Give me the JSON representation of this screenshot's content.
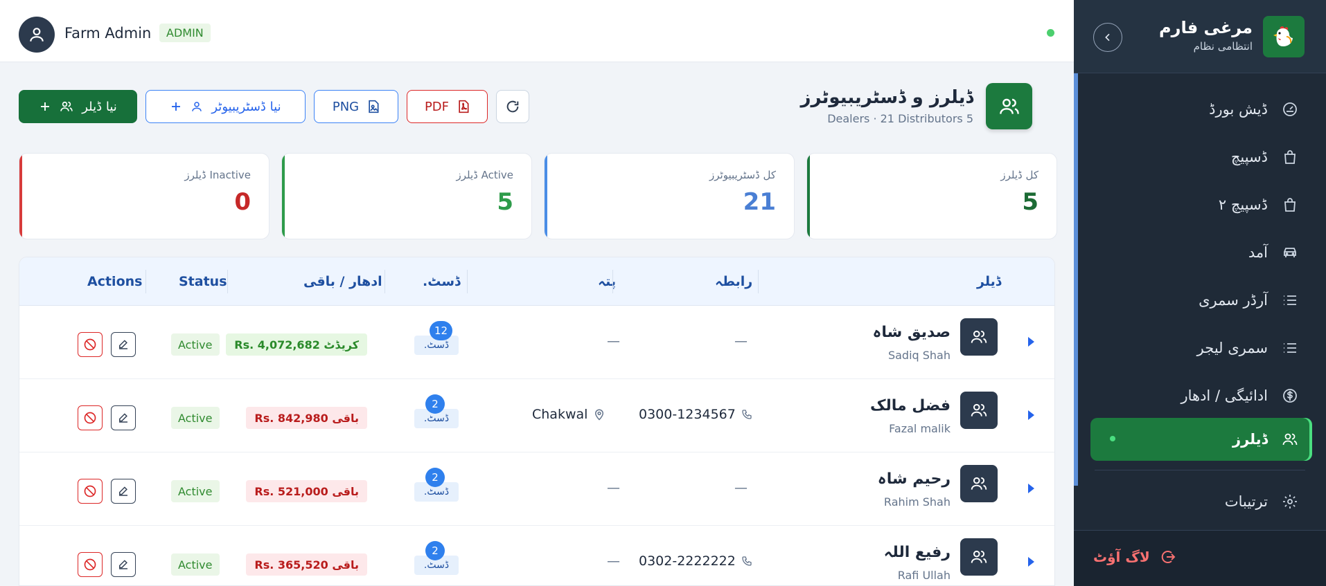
{
  "topbar": {
    "user_name": "Farm Admin",
    "role": "ADMIN"
  },
  "toolbar": {
    "new_dealer": "نیا ڈیلر",
    "new_distributor": "نیا ڈسٹریبیوٹر",
    "png": "PNG",
    "pdf": "PDF"
  },
  "page": {
    "title": "ڈیلرز و ڈسٹریبیوٹرز",
    "subtitle": "Dealers · 21 Distributors 5"
  },
  "stats": [
    {
      "label": "Inactive ڈیلرز",
      "value": "0"
    },
    {
      "label": "Active ڈیلرز",
      "value": "5"
    },
    {
      "label": "کل ڈسٹریبیوٹرز",
      "value": "21"
    },
    {
      "label": "کل ڈیلرز",
      "value": "5"
    }
  ],
  "table": {
    "headers": {
      "actions": "Actions",
      "status": "Status",
      "balance": "ادھار / باقی",
      "dist": "ڈسٹ.",
      "address": "پتہ",
      "contact": "رابطہ",
      "dealer": "ڈیلر"
    },
    "rows": [
      {
        "name_ur": "صدیق شاہ",
        "name_en": "Sadiq Shah",
        "contact": "—",
        "address": "—",
        "dist_count": "12",
        "dist_tag": "ڈسٹ.",
        "balance": "Rs. 4,072,682 کریڈٹ",
        "status": "Active"
      },
      {
        "name_ur": "فضل مالک",
        "name_en": "Fazal malik",
        "contact": "0300-1234567",
        "address": "Chakwal",
        "dist_count": "2",
        "dist_tag": "ڈسٹ.",
        "balance": "Rs. 842,980 باقی",
        "status": "Active"
      },
      {
        "name_ur": "رحیم شاہ",
        "name_en": "Rahim Shah",
        "contact": "—",
        "address": "—",
        "dist_count": "2",
        "dist_tag": "ڈسٹ.",
        "balance": "Rs. 521,000 باقی",
        "status": "Active"
      },
      {
        "name_ur": "رفیع اللہ",
        "name_en": "Rafi Ullah",
        "contact": "0302-2222222",
        "address": "—",
        "dist_count": "2",
        "dist_tag": "ڈسٹ.",
        "balance": "Rs. 365,520 باقی",
        "status": "Active"
      }
    ]
  },
  "sidebar": {
    "brand": "مرغی فارم",
    "tagline": "انتظامی نظام",
    "items": [
      {
        "label": "ڈیش بورڈ",
        "icon": "gauge-icon"
      },
      {
        "label": "ڈسپیچ",
        "icon": "bag-icon"
      },
      {
        "label": "ڈسپیچ ۲",
        "icon": "bag-icon"
      },
      {
        "label": "آمد",
        "icon": "car-icon"
      },
      {
        "label": "آرڈر سمری",
        "icon": "list-icon"
      },
      {
        "label": "سمری لیجر",
        "icon": "list-icon"
      },
      {
        "label": "ادائیگی / ادھار",
        "icon": "dollar-icon"
      },
      {
        "label": "ڈیلرز",
        "icon": "users-icon"
      }
    ],
    "settings": "ترتیبات",
    "logout": "لاگ آؤٹ"
  },
  "colors": {
    "primary_green": "#1c7a3e",
    "accent_blue": "#2563eb",
    "danger": "#dc2626",
    "sidebar_bg": "#1f2a37"
  }
}
